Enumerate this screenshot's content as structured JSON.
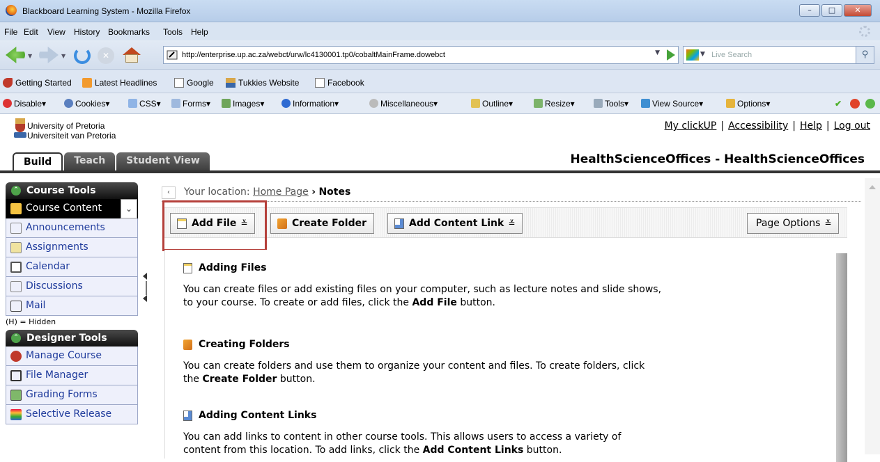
{
  "window": {
    "title": "Blackboard Learning System - Mozilla Firefox",
    "buttons": {
      "minimize": "–",
      "maximize": "□",
      "close": "✕"
    }
  },
  "menubar": {
    "items": [
      "File",
      "Edit",
      "View",
      "History",
      "Bookmarks",
      "Tools",
      "Help"
    ]
  },
  "navbar": {
    "url": "http://enterprise.up.ac.za/webct/urw/lc4130001.tp0/cobaltMainFrame.dowebct",
    "search_placeholder": "Live Search"
  },
  "bookmarks": [
    "Getting Started",
    "Latest Headlines",
    "Google",
    "Tukkies Website",
    "Facebook"
  ],
  "webdev": [
    "Disable▾",
    "Cookies▾",
    "CSS▾",
    "Forms▾",
    "Images▾",
    "Information▾",
    "Miscellaneous▾",
    "Outline▾",
    "Resize▾",
    "Tools▾",
    "View Source▾",
    "Options▾"
  ],
  "header": {
    "university_en": "University of Pretoria",
    "university_af": "Universiteit van Pretoria",
    "links": [
      "My clickUP",
      "Accessibility",
      "Help",
      "Log out"
    ],
    "separator": "|",
    "course_title": "HealthScienceOffices - HealthScienceOffices"
  },
  "tabs": [
    "Build",
    "Teach",
    "Student View"
  ],
  "sidebar": {
    "course_tools_title": "Course Tools",
    "course_tools": [
      "Course Content",
      "Announcements",
      "Assignments",
      "Calendar",
      "Discussions",
      "Mail"
    ],
    "hidden_note": "(H) = Hidden",
    "designer_tools_title": "Designer Tools",
    "designer_tools": [
      "Manage Course",
      "File Manager",
      "Grading Forms",
      "Selective Release"
    ]
  },
  "breadcrumb": {
    "prefix": "Your location:",
    "home": "Home Page",
    "arrow": "›",
    "current": "Notes"
  },
  "toolbar": {
    "add_file": "Add File",
    "create_folder": "Create Folder",
    "add_content_link": "Add Content Link",
    "page_options": "Page Options",
    "menu_caret": "≚"
  },
  "content": {
    "adding_files": {
      "title": "Adding Files",
      "line1": "You can create files or add existing files on your computer, such as lecture notes and slide shows,",
      "line2_pre": "to your course. To create or add files, click the ",
      "line2_bold": "Add File",
      "line2_post": " button."
    },
    "creating_folders": {
      "title": "Creating Folders",
      "line1": "You can create folders and use them to organize your content and files. To create folders, click",
      "line2_pre": "the ",
      "line2_bold": "Create Folder",
      "line2_post": " button."
    },
    "adding_links": {
      "title": "Adding Content Links",
      "line1": "You can add links to content in other course tools. This allows users to access a variety of",
      "line2_pre": "content from this location. To add links, click the ",
      "line2_bold": "Add Content Links",
      "line2_post": " button."
    }
  }
}
